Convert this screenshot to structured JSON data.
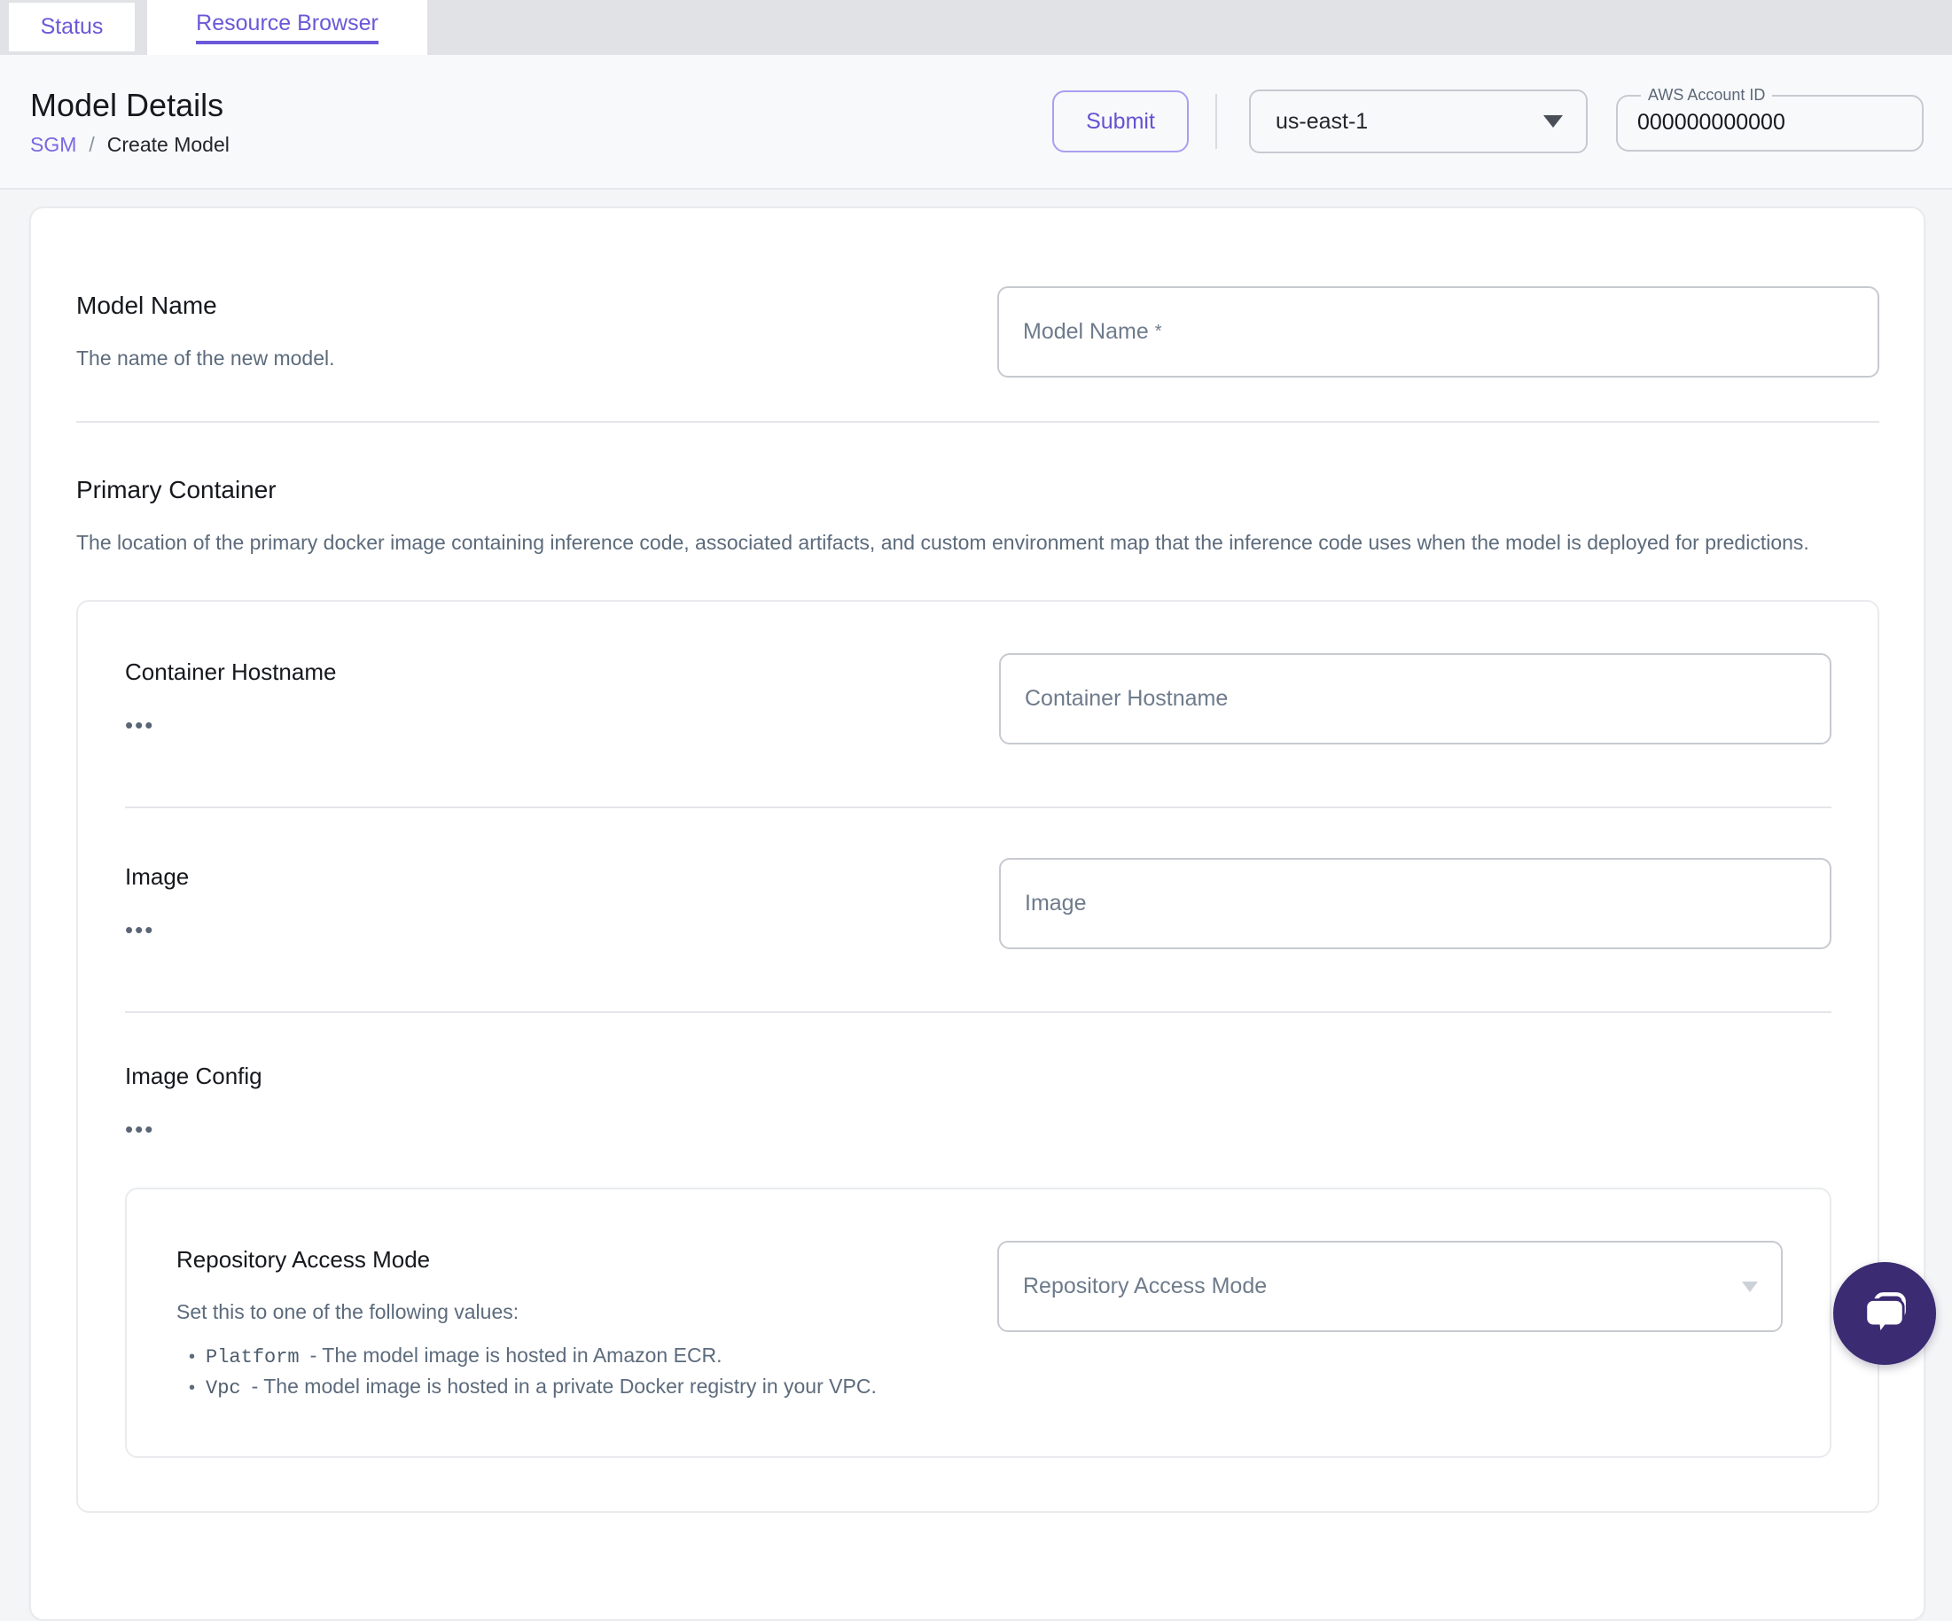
{
  "tabs": {
    "status": {
      "label": "Status"
    },
    "resource_browser": {
      "label": "Resource Browser"
    }
  },
  "header": {
    "title": "Model Details",
    "breadcrumb": {
      "root": "SGM",
      "separator": "/",
      "current": "Create Model"
    },
    "submit_label": "Submit",
    "region": {
      "value": "us-east-1"
    },
    "aws_account": {
      "label": "AWS Account ID",
      "value": "000000000000"
    }
  },
  "form": {
    "model_name": {
      "label": "Model Name",
      "description": "The name of the new model.",
      "placeholder": "Model Name",
      "required_marker": "*"
    },
    "primary_container": {
      "label": "Primary Container",
      "description": "The location of the primary docker image containing inference code, associated artifacts, and custom environment map that the inference code uses when the model is deployed for predictions.",
      "container_hostname": {
        "label": "Container Hostname",
        "placeholder": "Container Hostname"
      },
      "image": {
        "label": "Image",
        "placeholder": "Image"
      },
      "image_config": {
        "label": "Image Config",
        "repository_access_mode": {
          "label": "Repository Access Mode",
          "placeholder": "Repository Access Mode",
          "description": "Set this to one of the following values:",
          "options": [
            {
              "code": "Platform",
              "text": "- The model image is hosted in Amazon ECR."
            },
            {
              "code": "Vpc",
              "text": "- The model image is hosted in a private Docker registry in your VPC."
            }
          ]
        }
      }
    }
  },
  "icons": {
    "ellipsis": "•••"
  },
  "colors": {
    "accent_purple": "#6a58d8",
    "submit_purple": "#6353d2",
    "link_purple": "#7a68e2",
    "chat_widget": "#3b2b72",
    "tabbar_gray": "#e0e2e5",
    "text_slate": "#5c6b7c"
  }
}
